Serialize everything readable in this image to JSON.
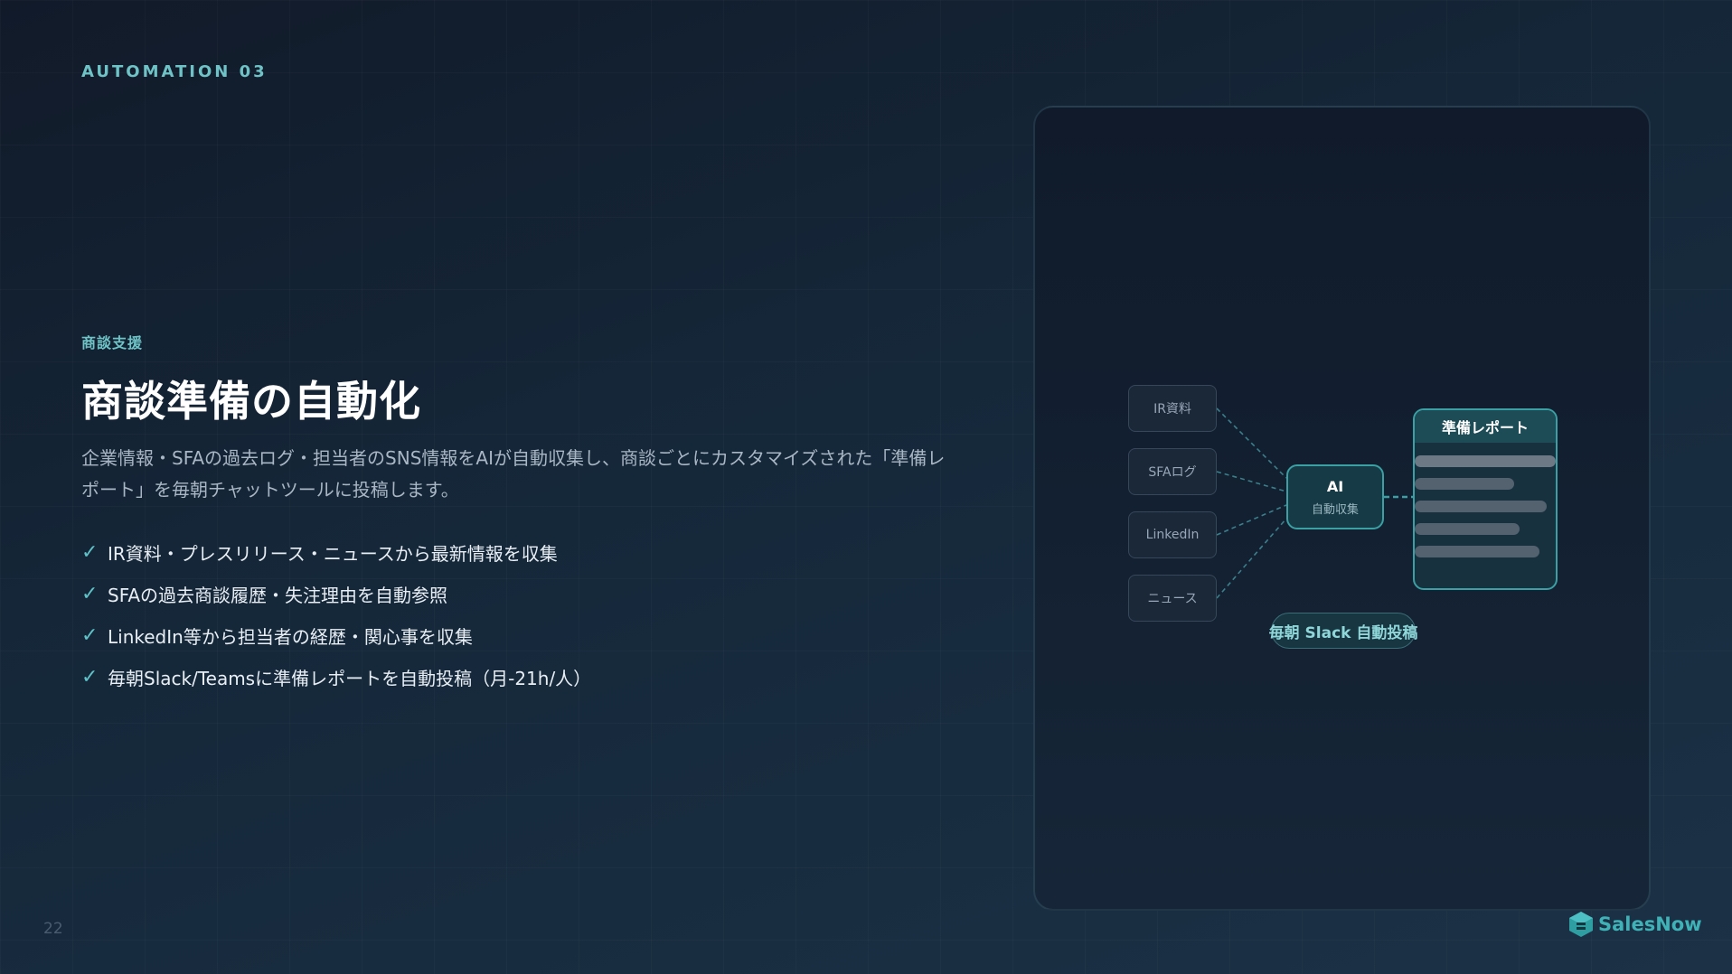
{
  "eyebrow": "AUTOMATION 03",
  "category": "商談支援",
  "title": "商談準備の自動化",
  "description": "企業情報・SFAの過去ログ・担当者のSNS情報をAIが自動収集し、商談ごとにカスタマイズされた「準備レポート」を毎朝チャットツールに投稿します。",
  "bullets": [
    "IR資料・プレスリリース・ニュースから最新情報を収集",
    "SFAの過去商談履歴・失注理由を自動参照",
    "LinkedIn等から担当者の経歴・関心事を収集",
    "毎朝Slack/Teamsに準備レポートを自動投稿（月-21h/人）"
  ],
  "check_symbol": "✓",
  "diagram": {
    "sources": [
      "IR資料",
      "SFAログ",
      "LinkedIn",
      "ニュース"
    ],
    "ai_label": "AI",
    "ai_sublabel": "自動収集",
    "report_title": "準備レポート",
    "output_label": "毎朝 Slack 自動投稿"
  },
  "page_number": "22",
  "brand": "SalesNow",
  "colors": {
    "accent": "#6fc3c6",
    "node_border": "#3aa0a4",
    "background": "#15283a"
  }
}
